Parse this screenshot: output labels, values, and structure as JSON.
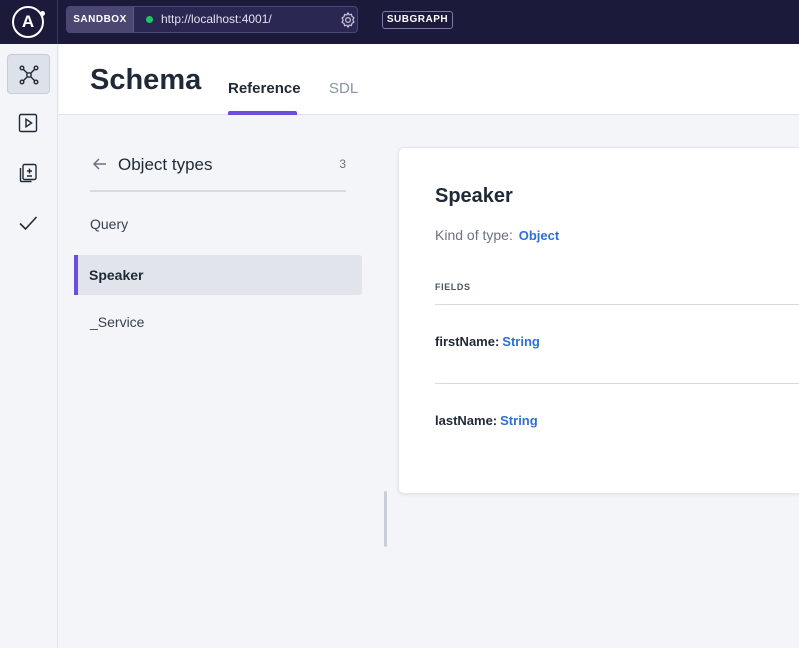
{
  "topbar": {
    "logo_letter": "A",
    "sandbox_label": "SANDBOX",
    "endpoint_url": "http://localhost:4001/",
    "subgraph_label": "SUBGRAPH",
    "status_color": "#22c55e"
  },
  "nav": {
    "items": [
      {
        "name": "schema",
        "icon": "graph-icon",
        "active": true
      },
      {
        "name": "explorer",
        "icon": "play-icon",
        "active": false
      },
      {
        "name": "changelog",
        "icon": "document-diff-icon",
        "active": false
      },
      {
        "name": "checks",
        "icon": "checkmark-icon",
        "active": false
      }
    ]
  },
  "header": {
    "title": "Schema",
    "tabs": [
      {
        "label": "Reference",
        "active": true
      },
      {
        "label": "SDL",
        "active": false
      }
    ]
  },
  "types_panel": {
    "title": "Object types",
    "count": "3",
    "items": [
      {
        "label": "Query",
        "active": false
      },
      {
        "label": "Speaker",
        "active": true
      },
      {
        "label": "_Service",
        "active": false
      }
    ]
  },
  "detail": {
    "title": "Speaker",
    "kind_label": "Kind of type:",
    "kind_value": "Object",
    "fields_label": "FIELDS",
    "fields": [
      {
        "name": "firstName:",
        "type": "String"
      },
      {
        "name": "lastName:",
        "type": "String"
      }
    ]
  },
  "colors": {
    "topbar_bg": "#1c1a3a",
    "accent": "#6b4fd8",
    "link": "#2f6fd6"
  }
}
